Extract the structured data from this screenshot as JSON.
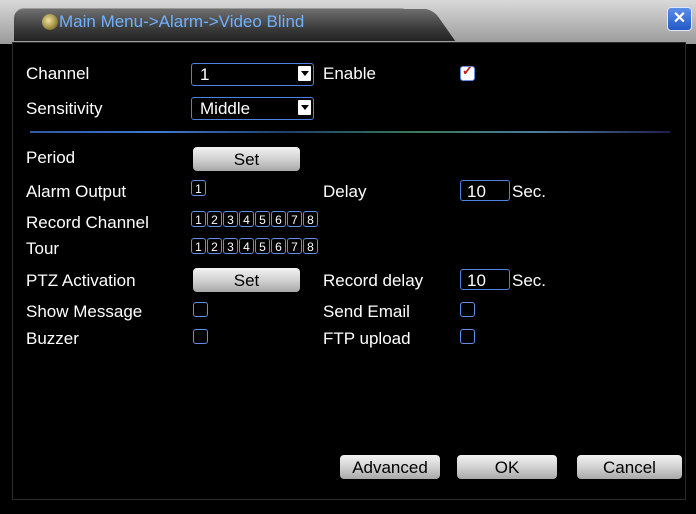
{
  "window": {
    "title": "Main Menu->Alarm->Video Blind",
    "close_glyph": "✕"
  },
  "form": {
    "channel": {
      "label": "Channel",
      "value": "1"
    },
    "enable": {
      "label": "Enable",
      "checked": true
    },
    "sensitivity": {
      "label": "Sensitivity",
      "value": "Middle"
    },
    "period": {
      "label": "Period",
      "button": "Set"
    },
    "alarm_output": {
      "label": "Alarm Output",
      "channels": [
        "1"
      ]
    },
    "delay": {
      "label": "Delay",
      "value": "10",
      "unit": "Sec."
    },
    "record_channel": {
      "label": "Record Channel",
      "channels": [
        "1",
        "2",
        "3",
        "4",
        "5",
        "6",
        "7",
        "8"
      ]
    },
    "tour": {
      "label": "Tour",
      "channels": [
        "1",
        "2",
        "3",
        "4",
        "5",
        "6",
        "7",
        "8"
      ]
    },
    "ptz_activation": {
      "label": "PTZ Activation",
      "button": "Set"
    },
    "record_delay": {
      "label": "Record delay",
      "value": "10",
      "unit": "Sec."
    },
    "show_message": {
      "label": "Show Message",
      "checked": false
    },
    "send_email": {
      "label": "Send Email",
      "checked": false
    },
    "buzzer": {
      "label": "Buzzer",
      "checked": false
    },
    "ftp_upload": {
      "label": "FTP upload",
      "checked": false
    }
  },
  "footer": {
    "advanced_label": "Advanced",
    "ok_label": "OK",
    "cancel_label": "Cancel"
  },
  "colors": {
    "accent_blue": "#4f82e0",
    "title_text": "#6fb1ff",
    "check_mark": "#d01010"
  }
}
